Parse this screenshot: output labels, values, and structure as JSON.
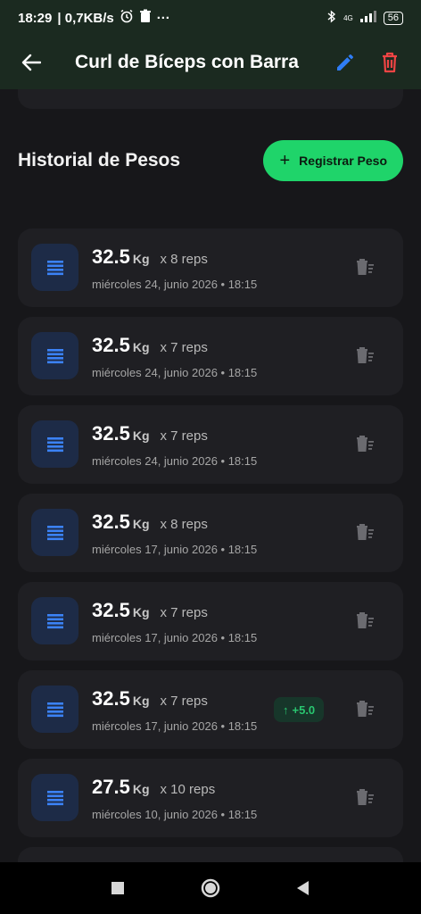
{
  "status_bar": {
    "time": "18:29",
    "speed": "| 0,7KB/s",
    "overflow": "···",
    "network": "4G",
    "battery": "56"
  },
  "app_bar": {
    "title": "Curl de Bíceps con Barra",
    "icons": {
      "back": "arrow-left-icon",
      "edit": "pencil-icon",
      "delete": "trash-icon"
    },
    "colors": {
      "edit": "#2f7df6",
      "delete": "#ef4444",
      "bar": "#1b2a20"
    }
  },
  "section": {
    "title": "Historial de Pesos",
    "add_button_label": "Registrar Peso",
    "add_button_color": "#1fd46a"
  },
  "entries": [
    {
      "weight": "32.5",
      "unit": "Kg",
      "reps": "x 8 reps",
      "date": "miércoles 24, junio 2026 • 18:15",
      "badge": ""
    },
    {
      "weight": "32.5",
      "unit": "Kg",
      "reps": "x 7 reps",
      "date": "miércoles 24, junio 2026 • 18:15",
      "badge": ""
    },
    {
      "weight": "32.5",
      "unit": "Kg",
      "reps": "x 7 reps",
      "date": "miércoles 24, junio 2026 • 18:15",
      "badge": ""
    },
    {
      "weight": "32.5",
      "unit": "Kg",
      "reps": "x 8 reps",
      "date": "miércoles 17, junio 2026 • 18:15",
      "badge": ""
    },
    {
      "weight": "32.5",
      "unit": "Kg",
      "reps": "x 7 reps",
      "date": "miércoles 17, junio 2026 • 18:15",
      "badge": ""
    },
    {
      "weight": "32.5",
      "unit": "Kg",
      "reps": "x 7 reps",
      "date": "miércoles 17, junio 2026 • 18:15",
      "badge": "+5.0"
    },
    {
      "weight": "27.5",
      "unit": "Kg",
      "reps": "x 10 reps",
      "date": "miércoles 10, junio 2026 • 18:15",
      "badge": ""
    }
  ],
  "nav_bar": {
    "icons": [
      "square-recents-icon",
      "circle-home-icon",
      "triangle-back-icon"
    ]
  }
}
